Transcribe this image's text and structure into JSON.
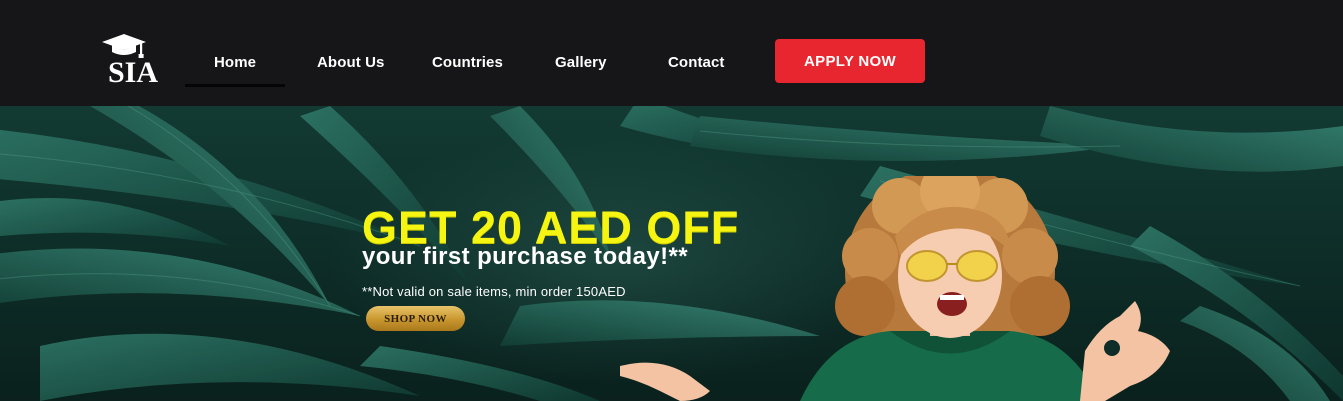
{
  "brand": {
    "logo_text": "SIA"
  },
  "nav": {
    "items": [
      {
        "label": "Home",
        "active": true
      },
      {
        "label": "About Us"
      },
      {
        "label": "Countries"
      },
      {
        "label": "Gallery"
      },
      {
        "label": "Contact"
      }
    ],
    "cta_label": "APPLY NOW"
  },
  "hero": {
    "headline": "GET 20 AED OFF",
    "subline": "your first purchase today!**",
    "disclaimer": "**Not valid on sale items, min order 150AED",
    "button_label": "SHOP NOW"
  },
  "colors": {
    "nav_bg": "#161618",
    "cta_red": "#e8262f",
    "headline_yellow": "#f5f511",
    "leaf_green": "#1d5b4f",
    "hoodie_green": "#156b4a"
  },
  "icons": {
    "logo": "graduation-cap-icon"
  }
}
